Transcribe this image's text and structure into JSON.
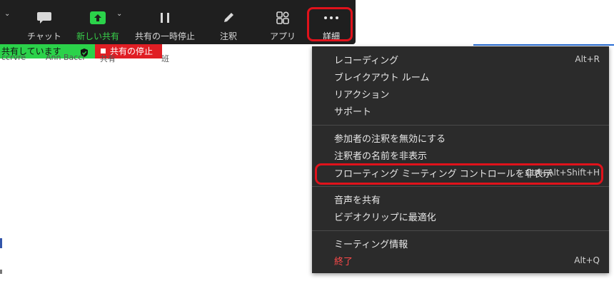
{
  "toolbar": {
    "chat_label": "チャット",
    "new_share_label": "新しい共有",
    "pause_share_label": "共有の一時停止",
    "annotate_label": "注釈",
    "apps_label": "アプリ",
    "more_label": "詳細",
    "accent_green": "#38d14a",
    "highlight_red": "#e0121b"
  },
  "share_bar": {
    "status_label": "共有しています",
    "stop_label": "共有の停止"
  },
  "background": {
    "frag1": "ccrvre",
    "frag2": "Ann Bacci",
    "frag3": "共有",
    "frag4": "班"
  },
  "menu": {
    "items": [
      {
        "label": "レコーディング",
        "shortcut": "Alt+R"
      },
      {
        "label": "ブレイクアウト ルーム",
        "shortcut": ""
      },
      {
        "label": "リアクション",
        "shortcut": ""
      },
      {
        "label": "サポート",
        "shortcut": ""
      },
      {
        "label": "参加者の注釈を無効にする",
        "shortcut": ""
      },
      {
        "label": "注釈者の名前を非表示",
        "shortcut": ""
      },
      {
        "label": "フローティング ミーティング コントロールを非表示",
        "shortcut": "Ctrl+Alt+Shift+H"
      },
      {
        "label": "音声を共有",
        "shortcut": ""
      },
      {
        "label": "ビデオクリップに最適化",
        "shortcut": ""
      },
      {
        "label": "ミーティング情報",
        "shortcut": ""
      },
      {
        "label": "終了",
        "shortcut": "Alt+Q"
      }
    ]
  }
}
